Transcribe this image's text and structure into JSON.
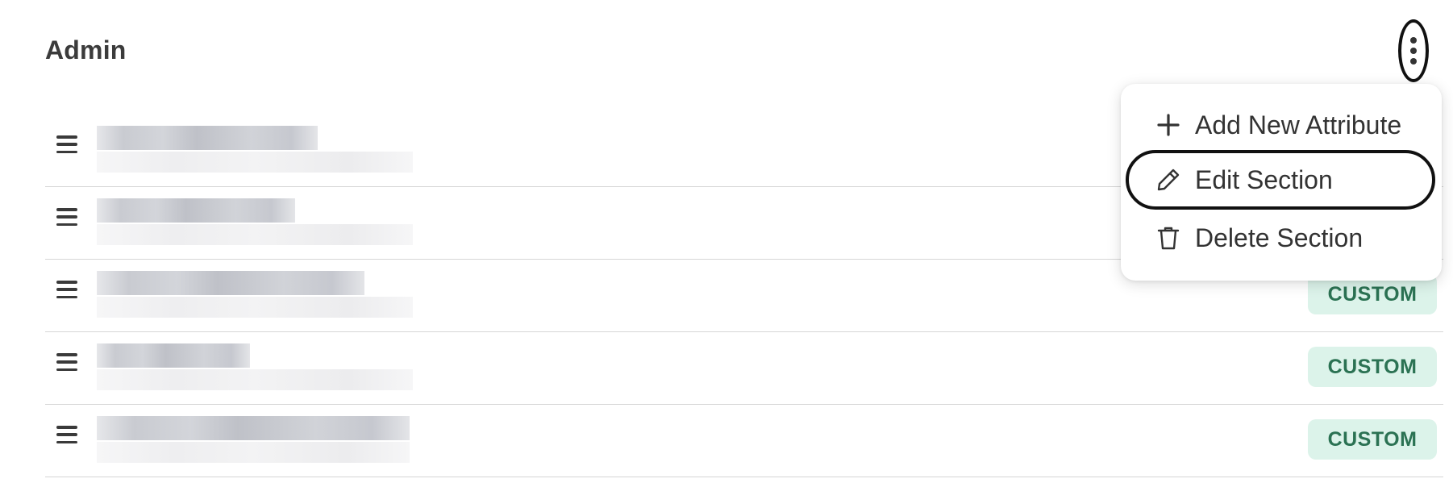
{
  "section": {
    "title": "Admin"
  },
  "menu": {
    "items": [
      {
        "label": "Add New Attribute",
        "icon": "plus-icon"
      },
      {
        "label": "Edit Section",
        "icon": "pencil-icon"
      },
      {
        "label": "Delete Section",
        "icon": "trash-icon"
      }
    ]
  },
  "attributes": {
    "rows": [
      {
        "name": "",
        "badge": ""
      },
      {
        "name": "",
        "badge": ""
      },
      {
        "name": "",
        "badge": "CUSTOM"
      },
      {
        "name": "",
        "badge": "CUSTOM"
      },
      {
        "name": "",
        "badge": "CUSTOM"
      }
    ]
  },
  "colors": {
    "badge_bg": "#dcf3ea",
    "badge_text": "#2b7253",
    "divider": "#d6d6d6"
  }
}
